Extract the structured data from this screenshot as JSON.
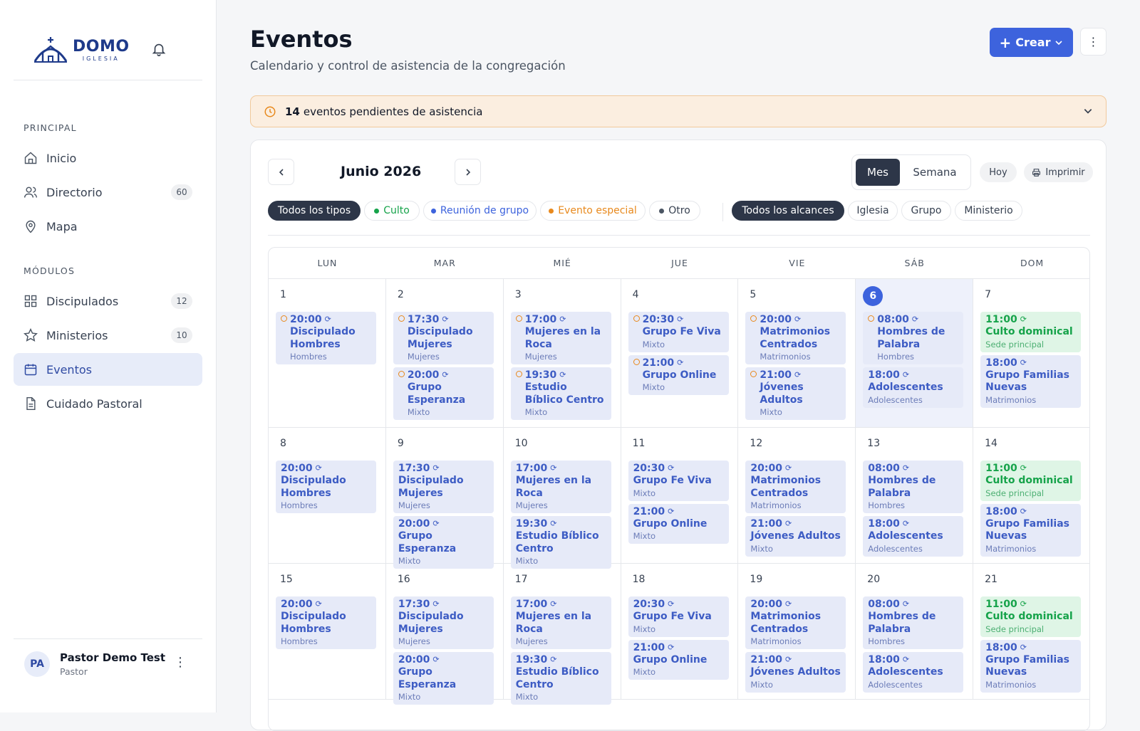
{
  "sidebar": {
    "logo": {
      "main": "DOMO",
      "sub": "IGLESIA"
    },
    "sections": {
      "principal": "PRINCIPAL",
      "modulos": "MÓDULOS"
    },
    "items": [
      {
        "label": "Inicio",
        "icon": "home-icon"
      },
      {
        "label": "Directorio",
        "icon": "users-icon",
        "badge": "60"
      },
      {
        "label": "Mapa",
        "icon": "map-pin-icon"
      },
      {
        "label": "Discipulados",
        "icon": "grid-icon",
        "badge": "12"
      },
      {
        "label": "Ministerios",
        "icon": "star-icon",
        "badge": "10"
      },
      {
        "label": "Eventos",
        "icon": "calendar-icon",
        "active": true
      },
      {
        "label": "Cuidado Pastoral",
        "icon": "document-icon"
      }
    ],
    "user": {
      "initials": "PA",
      "name": "Pastor Demo Test",
      "role": "Pastor"
    }
  },
  "header": {
    "title": "Eventos",
    "subtitle": "Calendario y control de asistencia de la congregación",
    "create_label": "Crear"
  },
  "alert": {
    "count": "14",
    "text": "eventos pendientes de asistencia"
  },
  "calendar": {
    "month_label": "Junio 2026",
    "view_mes": "Mes",
    "view_semana": "Semana",
    "hoy": "Hoy",
    "imprimir": "Imprimir",
    "type_filters": [
      "Todos los tipos",
      "Culto",
      "Reunión de grupo",
      "Evento especial",
      "Otro"
    ],
    "scope_filters": [
      "Todos los alcances",
      "Iglesia",
      "Grupo",
      "Ministerio"
    ],
    "filter_colors": {
      "Culto": "#16a34a",
      "Reunión de grupo": "#3d63dd",
      "Evento especial": "#e8891d",
      "Otro": "#4b5563"
    },
    "weekdays": [
      "LUN",
      "MAR",
      "MIÉ",
      "JUE",
      "VIE",
      "SÁB",
      "DOM"
    ],
    "weeks": [
      {
        "days": [
          {
            "num": "1",
            "events": [
              {
                "time": "20:00",
                "name": "Discipulado Hombres",
                "sub": "Hombres",
                "pending": true
              }
            ]
          },
          {
            "num": "2",
            "events": [
              {
                "time": "17:30",
                "name": "Discipulado Mujeres",
                "sub": "Mujeres",
                "pending": true
              },
              {
                "time": "20:00",
                "name": "Grupo Esperanza",
                "sub": "Mixto",
                "pending": true
              }
            ]
          },
          {
            "num": "3",
            "events": [
              {
                "time": "17:00",
                "name": "Mujeres en la Roca",
                "sub": "Mujeres",
                "pending": true
              },
              {
                "time": "19:30",
                "name": "Estudio Bíblico Centro",
                "sub": "Mixto",
                "pending": true
              }
            ]
          },
          {
            "num": "4",
            "events": [
              {
                "time": "20:30",
                "name": "Grupo Fe Viva",
                "sub": "Mixto",
                "pending": true
              },
              {
                "time": "21:00",
                "name": "Grupo Online",
                "sub": "Mixto",
                "pending": true
              }
            ]
          },
          {
            "num": "5",
            "events": [
              {
                "time": "20:00",
                "name": "Matrimonios Centrados",
                "sub": "Matrimonios",
                "pending": true
              },
              {
                "time": "21:00",
                "name": "Jóvenes Adultos",
                "sub": "Mixto",
                "pending": true
              }
            ]
          },
          {
            "num": "6",
            "today": true,
            "events": [
              {
                "time": "08:00",
                "name": "Hombres de Palabra",
                "sub": "Hombres",
                "pending": true
              },
              {
                "time": "18:00",
                "name": "Adolescentes",
                "sub": "Adolescentes"
              }
            ]
          },
          {
            "num": "7",
            "events": [
              {
                "time": "11:00",
                "name": "Culto dominical",
                "sub": "Sede principal",
                "culto": true
              },
              {
                "time": "18:00",
                "name": "Grupo Familias Nuevas",
                "sub": "Matrimonios"
              }
            ]
          }
        ]
      },
      {
        "days": [
          {
            "num": "8",
            "events": [
              {
                "time": "20:00",
                "name": "Discipulado Hombres",
                "sub": "Hombres"
              }
            ]
          },
          {
            "num": "9",
            "events": [
              {
                "time": "17:30",
                "name": "Discipulado Mujeres",
                "sub": "Mujeres"
              },
              {
                "time": "20:00",
                "name": "Grupo Esperanza",
                "sub": "Mixto"
              }
            ]
          },
          {
            "num": "10",
            "events": [
              {
                "time": "17:00",
                "name": "Mujeres en la Roca",
                "sub": "Mujeres"
              },
              {
                "time": "19:30",
                "name": "Estudio Bíblico Centro",
                "sub": "Mixto"
              }
            ]
          },
          {
            "num": "11",
            "events": [
              {
                "time": "20:30",
                "name": "Grupo Fe Viva",
                "sub": "Mixto"
              },
              {
                "time": "21:00",
                "name": "Grupo Online",
                "sub": "Mixto"
              }
            ]
          },
          {
            "num": "12",
            "events": [
              {
                "time": "20:00",
                "name": "Matrimonios Centrados",
                "sub": "Matrimonios"
              },
              {
                "time": "21:00",
                "name": "Jóvenes Adultos",
                "sub": "Mixto"
              }
            ]
          },
          {
            "num": "13",
            "events": [
              {
                "time": "08:00",
                "name": "Hombres de Palabra",
                "sub": "Hombres"
              },
              {
                "time": "18:00",
                "name": "Adolescentes",
                "sub": "Adolescentes"
              }
            ]
          },
          {
            "num": "14",
            "events": [
              {
                "time": "11:00",
                "name": "Culto dominical",
                "sub": "Sede principal",
                "culto": true
              },
              {
                "time": "18:00",
                "name": "Grupo Familias Nuevas",
                "sub": "Matrimonios"
              }
            ]
          }
        ]
      },
      {
        "days": [
          {
            "num": "15",
            "events": [
              {
                "time": "20:00",
                "name": "Discipulado Hombres",
                "sub": "Hombres"
              }
            ]
          },
          {
            "num": "16",
            "events": [
              {
                "time": "17:30",
                "name": "Discipulado Mujeres",
                "sub": "Mujeres"
              },
              {
                "time": "20:00",
                "name": "Grupo Esperanza",
                "sub": "Mixto"
              }
            ]
          },
          {
            "num": "17",
            "events": [
              {
                "time": "17:00",
                "name": "Mujeres en la Roca",
                "sub": "Mujeres"
              },
              {
                "time": "19:30",
                "name": "Estudio Bíblico Centro",
                "sub": "Mixto"
              }
            ]
          },
          {
            "num": "18",
            "events": [
              {
                "time": "20:30",
                "name": "Grupo Fe Viva",
                "sub": "Mixto"
              },
              {
                "time": "21:00",
                "name": "Grupo Online",
                "sub": "Mixto"
              }
            ]
          },
          {
            "num": "19",
            "events": [
              {
                "time": "20:00",
                "name": "Matrimonios Centrados",
                "sub": "Matrimonios"
              },
              {
                "time": "21:00",
                "name": "Jóvenes Adultos",
                "sub": "Mixto"
              }
            ]
          },
          {
            "num": "20",
            "events": [
              {
                "time": "08:00",
                "name": "Hombres de Palabra",
                "sub": "Hombres"
              },
              {
                "time": "18:00",
                "name": "Adolescentes",
                "sub": "Adolescentes"
              }
            ]
          },
          {
            "num": "21",
            "events": [
              {
                "time": "11:00",
                "name": "Culto dominical",
                "sub": "Sede principal",
                "culto": true
              },
              {
                "time": "18:00",
                "name": "Grupo Familias Nuevas",
                "sub": "Matrimonios"
              }
            ]
          }
        ]
      }
    ]
  }
}
